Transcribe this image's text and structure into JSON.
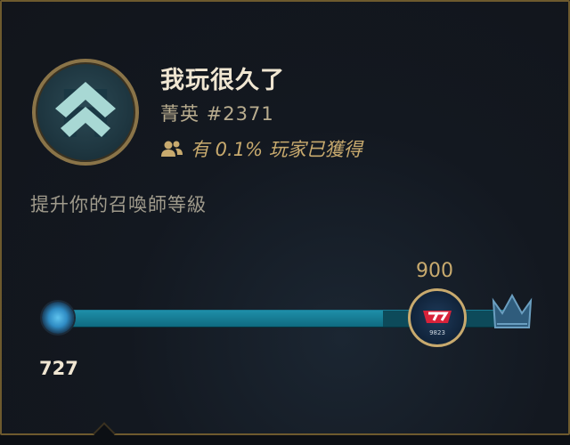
{
  "challenge": {
    "title": "我玩很久了",
    "rank_label": "菁英",
    "rank_number": "#2371",
    "owned_text": "有 0.1% 玩家已獲得",
    "description": "提升你的召喚師等級"
  },
  "progress": {
    "current_value": "727",
    "next_threshold": "900",
    "progress_fraction": 0.727,
    "next_badge_label": "9823"
  },
  "colors": {
    "gold": "#c8aa6e",
    "title_text": "#f0e6d2",
    "bar_fill": "#1e8ea8"
  },
  "icons": {
    "emblem": "chevron-up-emblem-icon",
    "players": "players-icon",
    "next_reward": "team-logo-badge-icon",
    "max_tier": "crown-icon"
  }
}
